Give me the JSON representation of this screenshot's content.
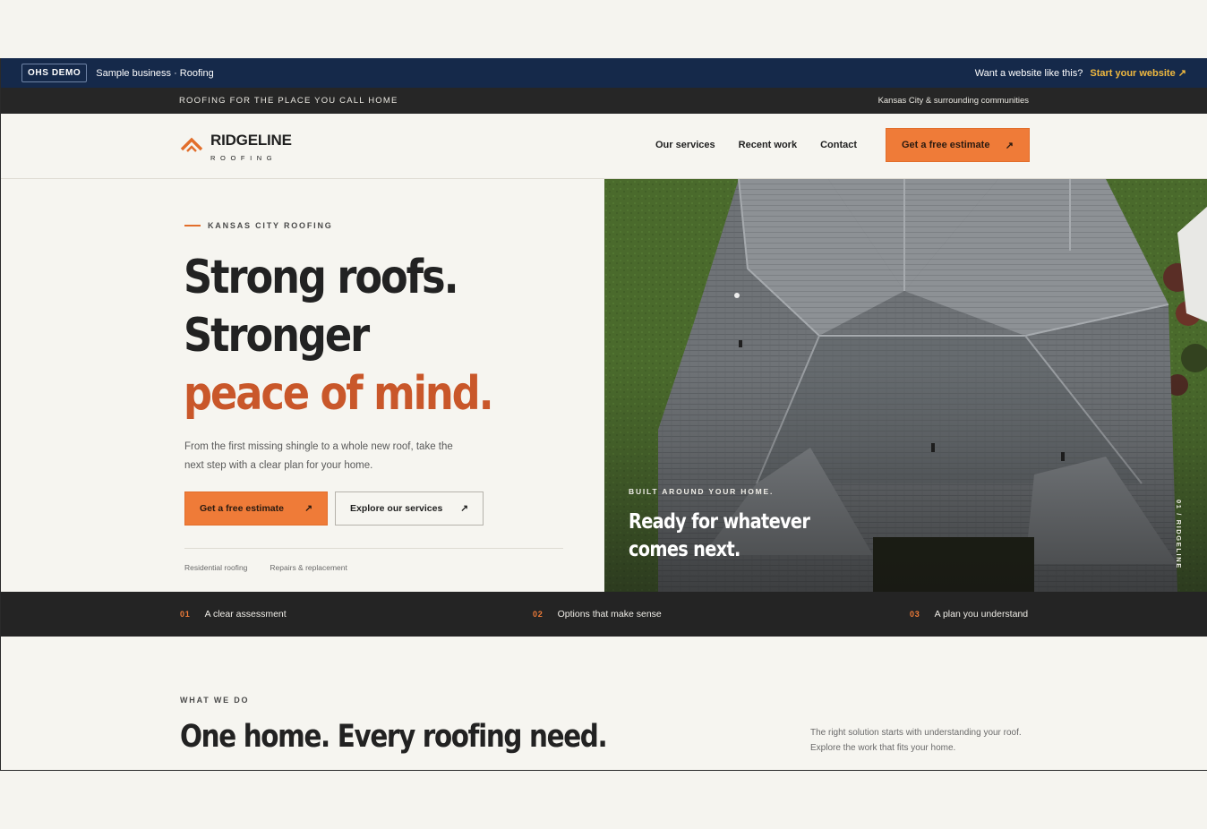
{
  "demo_bar": {
    "badge": "OHS DEMO",
    "business": "Sample business · Roofing",
    "question": "Want a website like this?",
    "cta": "Start your website ↗"
  },
  "announce": {
    "left": "ROOFING FOR THE PLACE YOU CALL HOME",
    "right": "Kansas City & surrounding communities"
  },
  "header": {
    "logo_name": "RIDGELINE",
    "logo_sub": "ROOFING",
    "nav": [
      "Our services",
      "Recent work",
      "Contact"
    ],
    "cta": "Get a free estimate",
    "cta_icon": "↗"
  },
  "hero": {
    "eyebrow": "KANSAS CITY ROOFING",
    "headline_1": "Strong roofs.",
    "headline_2": "Stronger",
    "headline_3": "peace of mind.",
    "description": "From the first missing shingle to a whole new roof, take the next step with a clear plan for your home.",
    "primary_cta": "Get a free estimate",
    "secondary_cta": "Explore our services",
    "arrow": "↗",
    "tags": [
      "Residential roofing",
      "Repairs & replacement"
    ]
  },
  "hero_image": {
    "eyebrow": "BUILT AROUND YOUR HOME.",
    "title": "Ready for whatever comes next.",
    "vertical": "01 / RIDGELINE"
  },
  "steps": [
    {
      "num": "01",
      "label": "A clear assessment"
    },
    {
      "num": "02",
      "label": "Options that make sense"
    },
    {
      "num": "03",
      "label": "A plan you understand"
    }
  ],
  "section": {
    "eyebrow": "WHAT WE DO",
    "title": "One home. Every roofing need.",
    "description": "The right solution starts with understanding your roof. Explore the work that fits your home."
  },
  "colors": {
    "accent": "#ef7b38",
    "accent_dark": "#c9572a",
    "navy": "#15294a",
    "dark": "#242424",
    "link_yellow": "#f0b93f"
  }
}
